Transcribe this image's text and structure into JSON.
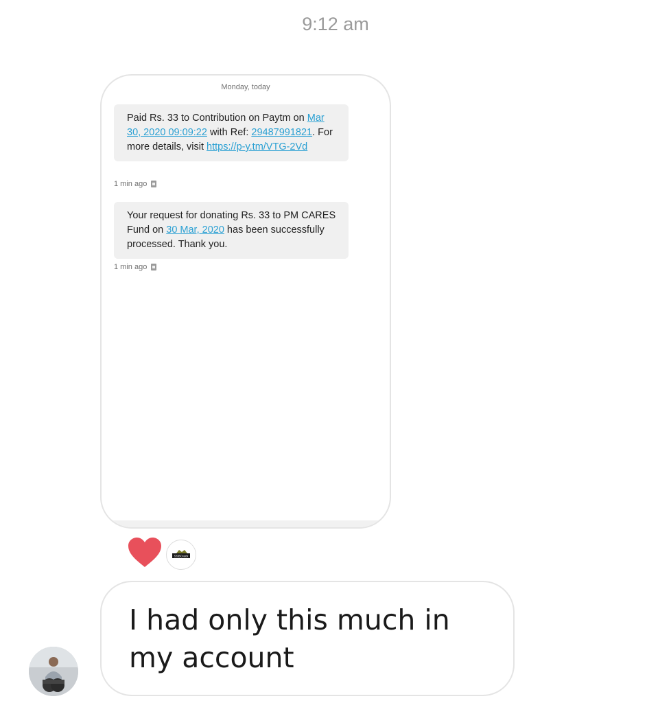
{
  "header": {
    "time": "9:12 am"
  },
  "shared_message": {
    "date_label": "Monday, today",
    "sms": [
      {
        "parts": [
          {
            "text": "Paid Rs. 33 to Contribution on Paytm on ",
            "link": false
          },
          {
            "text": "Mar 30, 2020 09:09:22",
            "link": true
          },
          {
            "text": " with Ref: ",
            "link": false
          },
          {
            "text": "29487991821",
            "link": true
          },
          {
            "text": ". For more details, visit ",
            "link": false
          },
          {
            "text": "https://p-y.tm/VTG-2Vd",
            "link": true
          }
        ],
        "time": "1 min ago"
      },
      {
        "parts": [
          {
            "text": " Your request for donating Rs. 33 to PM CARES Fund on ",
            "link": false
          },
          {
            "text": "30 Mar, 2020",
            "link": true
          },
          {
            "text": " has been successfully processed. Thank you.",
            "link": false
          }
        ],
        "time": "1 min ago"
      }
    ]
  },
  "reactions": {
    "emoji": "heart-icon",
    "reactor_label": "SSBCrack"
  },
  "reply": {
    "text": "I had only this much in my account"
  },
  "colors": {
    "link": "#2aa0d3",
    "heart": "#e8505b",
    "bubble": "#f0f0f0"
  }
}
